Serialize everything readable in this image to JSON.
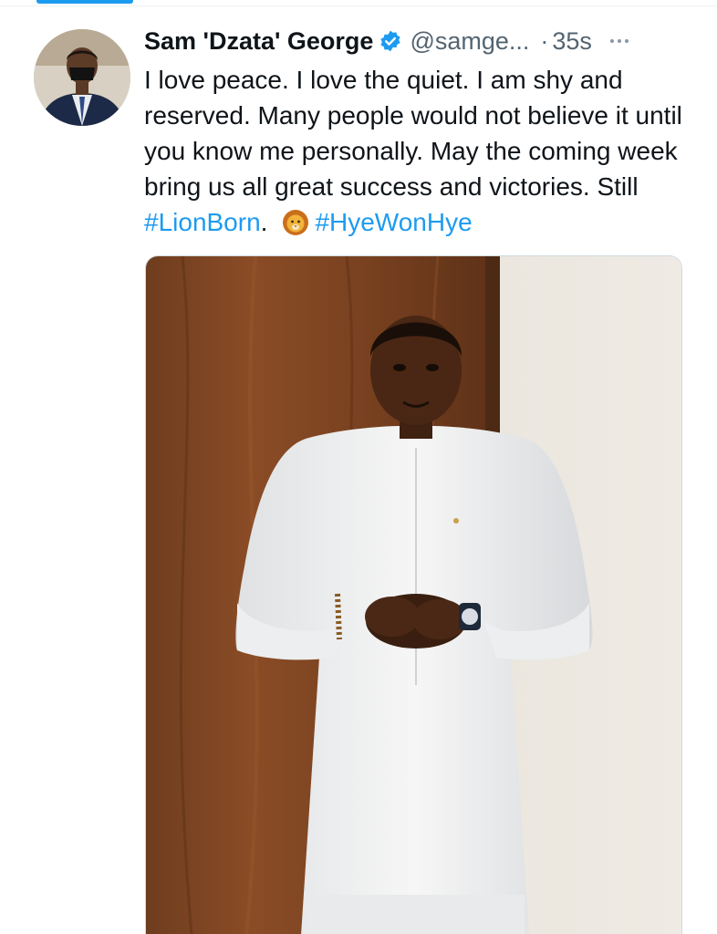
{
  "tweet": {
    "author": {
      "display_name": "Sam 'Dzata' George",
      "handle": "@samge...",
      "verified": true,
      "avatar_icon": "profile-photo-man-in-suit-with-mask"
    },
    "separator": "·",
    "timestamp": "35s",
    "text_parts": {
      "body": "I love peace. I love the quiet. I am shy and reserved. Many people would not believe it until you know me personally. May the coming week bring us all great success and victories. Still ",
      "hashtag1": "#LionBorn",
      "after_hashtag1": ".",
      "emoji_icon": "lion-emoji",
      "hashtag2": "#HyeWonHye"
    },
    "media_icon": "photo-man-in-white-kaftan"
  },
  "colors": {
    "accent": "#1d9bf0",
    "text_primary": "#0f1419",
    "text_secondary": "#536471"
  }
}
